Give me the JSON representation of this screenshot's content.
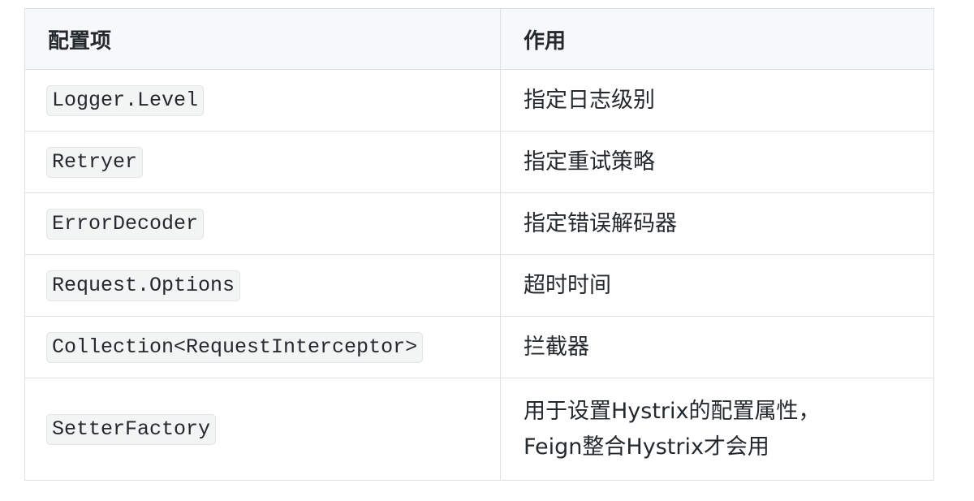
{
  "table": {
    "headers": [
      "配置项",
      "作用"
    ],
    "rows": [
      {
        "item": "Logger.Level",
        "desc": [
          "指定日志级别"
        ]
      },
      {
        "item": "Retryer",
        "desc": [
          "指定重试策略"
        ]
      },
      {
        "item": "ErrorDecoder",
        "desc": [
          "指定错误解码器"
        ]
      },
      {
        "item": "Request.Options",
        "desc": [
          "超时时间"
        ]
      },
      {
        "item": "Collection<RequestInterceptor>",
        "desc": [
          "拦截器"
        ]
      },
      {
        "item": "SetterFactory",
        "desc": [
          "用于设置Hystrix的配置属性，",
          "Feign整合Hystrix才会用"
        ]
      }
    ]
  }
}
